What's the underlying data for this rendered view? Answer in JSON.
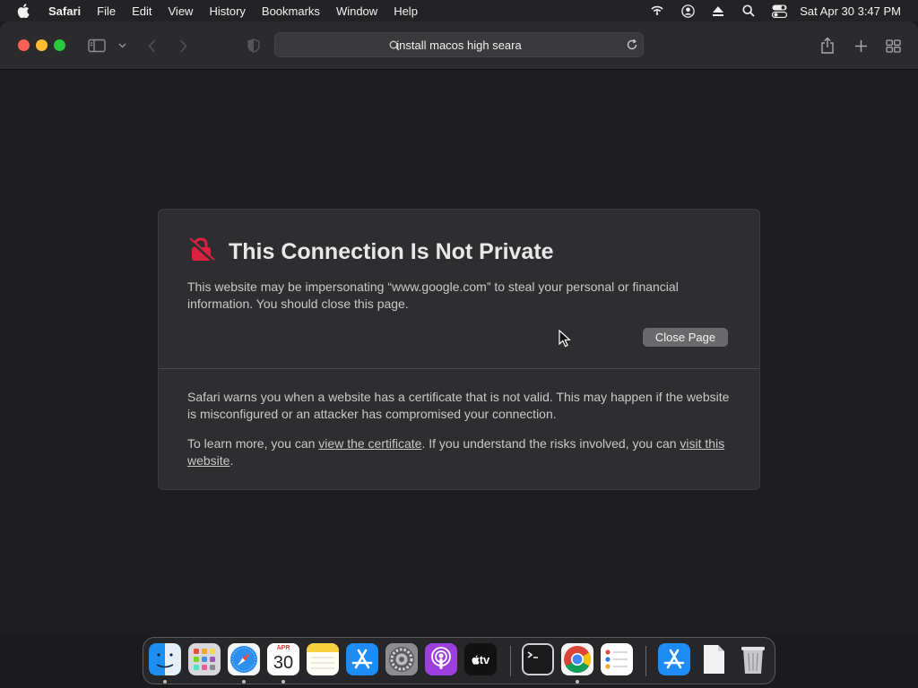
{
  "menubar": {
    "app": "Safari",
    "items": [
      "File",
      "Edit",
      "View",
      "History",
      "Bookmarks",
      "Window",
      "Help"
    ],
    "clock": "Sat Apr 30  3:47 PM",
    "status_icons": [
      "wifi-icon",
      "user-icon",
      "eject-icon",
      "search-icon",
      "control-center-icon"
    ]
  },
  "toolbar": {
    "address": "install macos high seara"
  },
  "warning": {
    "title": "This Connection Is Not Private",
    "lead": "This website may be impersonating “www.google.com” to steal your personal or financial information. You should close this page.",
    "close_button": "Close Page",
    "detail1": "Safari warns you when a website has a certificate that is not valid. This may happen if the website is misconfigured or an attacker has compromised your connection.",
    "detail2_before": "To learn more, you can ",
    "detail2_link1": "view the certificate",
    "detail2_middle": ". If you understand the risks involved, you can ",
    "detail2_link2": "visit this website",
    "detail2_after": ".",
    "accent_color": "#d9223f"
  },
  "dock": {
    "calendar_month": "APR",
    "calendar_day": "30",
    "tv_label": "tv",
    "apps": [
      "Finder",
      "Launchpad",
      "Safari",
      "Calendar",
      "Notes",
      "App Store",
      "System Preferences",
      "Podcasts",
      "TV",
      "Terminal",
      "Chrome",
      "Reminders",
      "App Store",
      "Document",
      "Trash"
    ]
  }
}
